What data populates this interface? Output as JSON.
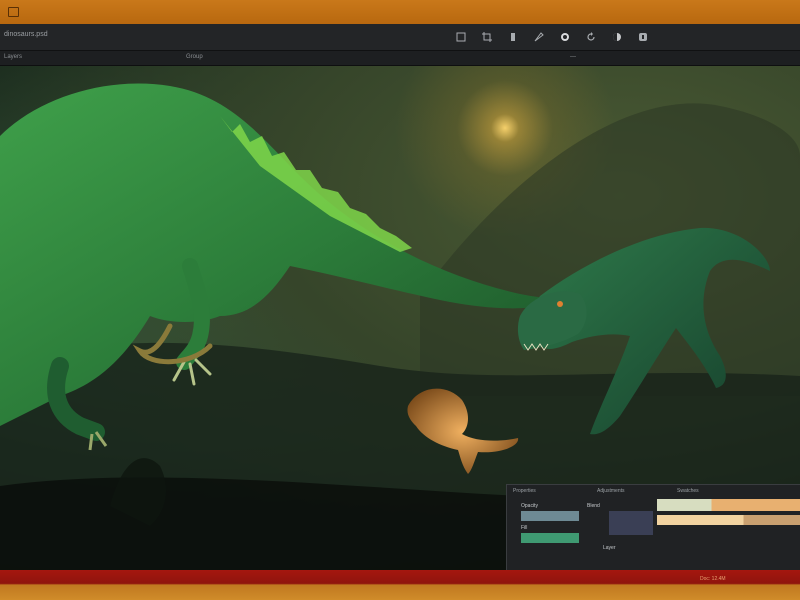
{
  "window": {
    "title": "dinosaurs.psd",
    "accent_color": "#c9781a",
    "bottom_color": "#a5170f"
  },
  "toolbar": {
    "tools": [
      "select-icon",
      "crop-icon",
      "brush-icon",
      "pen-icon",
      "fill-icon",
      "rotate-icon",
      "layers-icon",
      "history-icon"
    ]
  },
  "subbar": {
    "left_label": "Layers",
    "mid_label": "Group",
    "right_label": "—"
  },
  "panel": {
    "header_left": "Properties",
    "header_mid": "Adjustments",
    "header_right": "Swatches",
    "row1": "Opacity",
    "row2": "Fill",
    "row3": "Blend",
    "row4": "Layer",
    "swatches": [
      "#6e8a94",
      "#3a3f55",
      "#e8b070",
      "#d7ddc0",
      "#3f9a72"
    ]
  },
  "status": {
    "left_text": "Doc: 12.4M"
  }
}
